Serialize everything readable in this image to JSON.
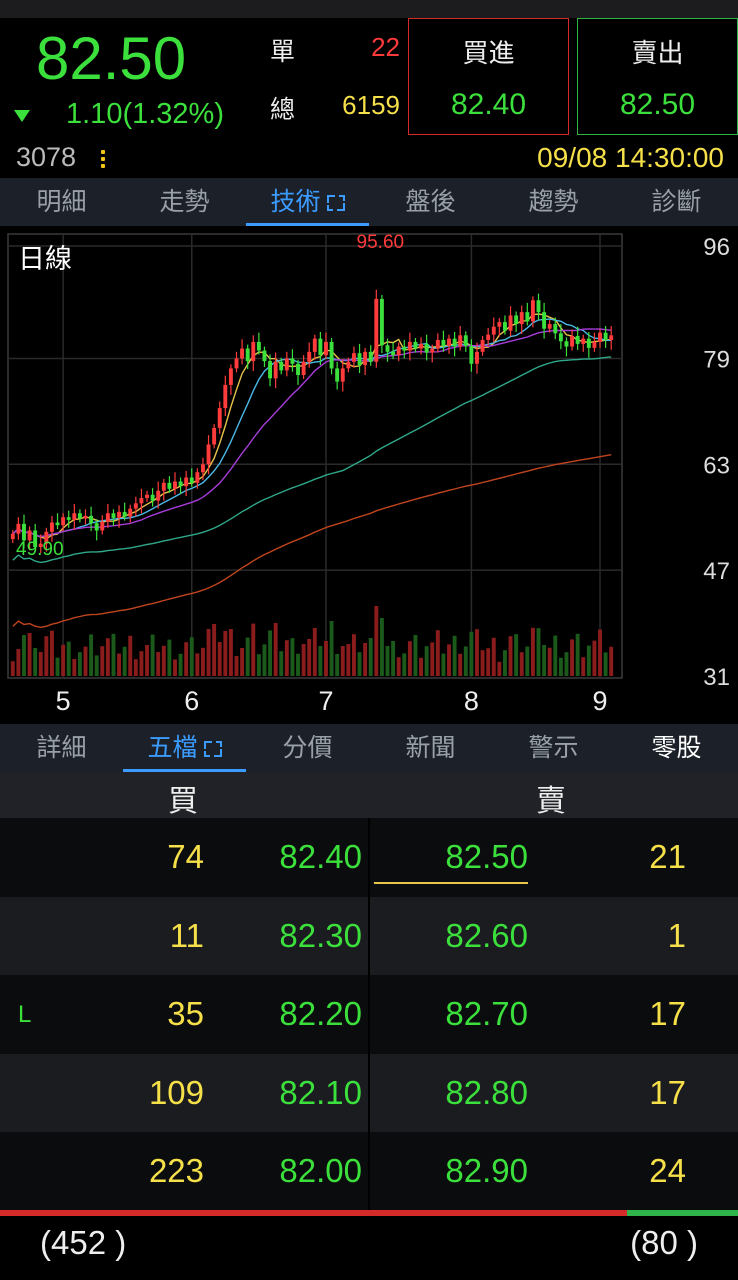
{
  "quote": {
    "price": "82.50",
    "change": "1.10(1.32%)",
    "dan_label": "單",
    "dan_value": "22",
    "zong_label": "總",
    "zong_value": "6159",
    "buy_label": "買進",
    "buy_price": "82.40",
    "sell_label": "賣出",
    "sell_price": "82.50",
    "code": "3078",
    "datetime": "09/08 14:30:00",
    "colors": {
      "up": "#ff3b3b",
      "down": "#3ce03c",
      "volume": "#f5e04a",
      "accent": "#3b9bff"
    }
  },
  "tabs_top": [
    {
      "label": "明細"
    },
    {
      "label": "走勢"
    },
    {
      "label": "技術",
      "active": true,
      "icon": "expand-icon"
    },
    {
      "label": "盤後"
    },
    {
      "label": "趨勢"
    },
    {
      "label": "診斷"
    }
  ],
  "tabs_bottom": [
    {
      "label": "詳細"
    },
    {
      "label": "五檔",
      "active": true,
      "icon": "expand-icon"
    },
    {
      "label": "分價"
    },
    {
      "label": "新聞"
    },
    {
      "label": "警示"
    },
    {
      "label": "零股"
    }
  ],
  "chart_data": {
    "type": "candlestick",
    "title": "日線",
    "period_label": "日線",
    "x_tick_labels": [
      "5",
      "6",
      "7",
      "8",
      "9"
    ],
    "y_tick_labels": [
      "96",
      "79",
      "63",
      "47",
      "31"
    ],
    "ylim": [
      31,
      96
    ],
    "high_marker": "95.60",
    "low_marker": "49.90",
    "grid": true,
    "closes": [
      52.5,
      54.0,
      51.5,
      53.0,
      50.5,
      51.0,
      52.8,
      54.2,
      53.8,
      55.0,
      54.6,
      55.6,
      54.8,
      55.2,
      54.1,
      53.0,
      54.3,
      55.6,
      54.9,
      55.8,
      55.1,
      56.3,
      57.1,
      57.9,
      58.4,
      57.5,
      59.0,
      60.2,
      59.3,
      60.4,
      59.7,
      61.0,
      60.2,
      61.8,
      63.0,
      66.0,
      68.5,
      71.5,
      75.0,
      77.5,
      79.0,
      80.5,
      78.6,
      81.5,
      80.2,
      78.6,
      76.0,
      78.5,
      77.2,
      79.0,
      78.2,
      76.5,
      78.5,
      80.0,
      82.0,
      79.5,
      81.5,
      77.5,
      75.5,
      77.5,
      78.5,
      79.8,
      78.0,
      80.0,
      78.5,
      88.0,
      81.0,
      80.0,
      79.5,
      80.8,
      80.2,
      81.5,
      80.5,
      81.2,
      79.9,
      80.5,
      81.8,
      80.9,
      82.0,
      80.8,
      82.5,
      80.9,
      78.2,
      80.0,
      81.8,
      82.6,
      83.8,
      84.5,
      83.2,
      85.5,
      84.2,
      86.0,
      84.6,
      87.8,
      86.0,
      83.5,
      84.2,
      82.8,
      81.6,
      80.8,
      82.4,
      81.2,
      82.0,
      80.6,
      81.5,
      82.9,
      81.8,
      82.5
    ],
    "ma_lines": [
      "MA5",
      "MA10",
      "MA20",
      "MA60",
      "MA120"
    ]
  },
  "orderbook": {
    "buy_header": "買",
    "sell_header": "賣",
    "rows": [
      {
        "flag": "",
        "bid_qty": "74",
        "bid": "82.40",
        "ask": "82.50",
        "ask_qty": "21"
      },
      {
        "flag": "",
        "bid_qty": "11",
        "bid": "82.30",
        "ask": "82.60",
        "ask_qty": "1"
      },
      {
        "flag": "L",
        "bid_qty": "35",
        "bid": "82.20",
        "ask": "82.70",
        "ask_qty": "17"
      },
      {
        "flag": "",
        "bid_qty": "109",
        "bid": "82.10",
        "ask": "82.80",
        "ask_qty": "17"
      },
      {
        "flag": "",
        "bid_qty": "223",
        "bid": "82.00",
        "ask": "82.90",
        "ask_qty": "24"
      }
    ],
    "total_buy": "(452 )",
    "total_sell": "(80 )",
    "buy_ratio": 0.85
  }
}
